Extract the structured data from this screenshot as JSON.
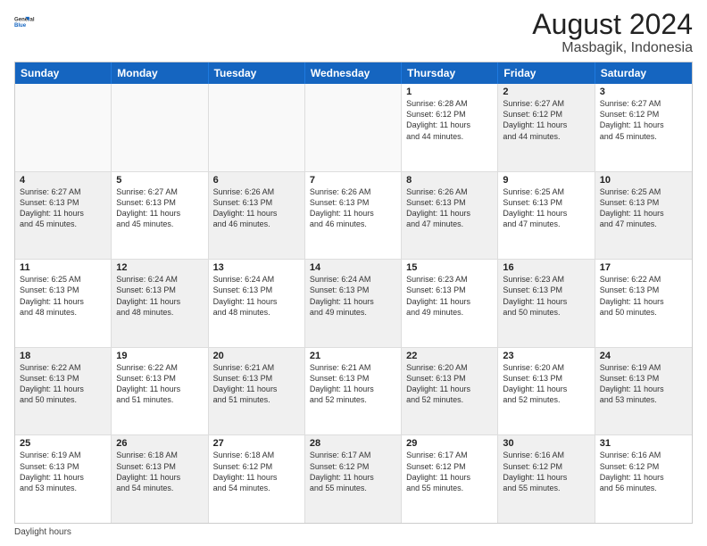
{
  "header": {
    "logo_general": "General",
    "logo_blue": "Blue",
    "month_title": "August 2024",
    "location": "Masbagik, Indonesia"
  },
  "days_of_week": [
    "Sunday",
    "Monday",
    "Tuesday",
    "Wednesday",
    "Thursday",
    "Friday",
    "Saturday"
  ],
  "footer": {
    "daylight_label": "Daylight hours"
  },
  "rows": [
    [
      {
        "day": "",
        "text": "",
        "shaded": false,
        "empty": true
      },
      {
        "day": "",
        "text": "",
        "shaded": false,
        "empty": true
      },
      {
        "day": "",
        "text": "",
        "shaded": false,
        "empty": true
      },
      {
        "day": "",
        "text": "",
        "shaded": false,
        "empty": true
      },
      {
        "day": "1",
        "text": "Sunrise: 6:28 AM\nSunset: 6:12 PM\nDaylight: 11 hours\nand 44 minutes.",
        "shaded": false,
        "empty": false
      },
      {
        "day": "2",
        "text": "Sunrise: 6:27 AM\nSunset: 6:12 PM\nDaylight: 11 hours\nand 44 minutes.",
        "shaded": true,
        "empty": false
      },
      {
        "day": "3",
        "text": "Sunrise: 6:27 AM\nSunset: 6:12 PM\nDaylight: 11 hours\nand 45 minutes.",
        "shaded": false,
        "empty": false
      }
    ],
    [
      {
        "day": "4",
        "text": "Sunrise: 6:27 AM\nSunset: 6:13 PM\nDaylight: 11 hours\nand 45 minutes.",
        "shaded": true,
        "empty": false
      },
      {
        "day": "5",
        "text": "Sunrise: 6:27 AM\nSunset: 6:13 PM\nDaylight: 11 hours\nand 45 minutes.",
        "shaded": false,
        "empty": false
      },
      {
        "day": "6",
        "text": "Sunrise: 6:26 AM\nSunset: 6:13 PM\nDaylight: 11 hours\nand 46 minutes.",
        "shaded": true,
        "empty": false
      },
      {
        "day": "7",
        "text": "Sunrise: 6:26 AM\nSunset: 6:13 PM\nDaylight: 11 hours\nand 46 minutes.",
        "shaded": false,
        "empty": false
      },
      {
        "day": "8",
        "text": "Sunrise: 6:26 AM\nSunset: 6:13 PM\nDaylight: 11 hours\nand 47 minutes.",
        "shaded": true,
        "empty": false
      },
      {
        "day": "9",
        "text": "Sunrise: 6:25 AM\nSunset: 6:13 PM\nDaylight: 11 hours\nand 47 minutes.",
        "shaded": false,
        "empty": false
      },
      {
        "day": "10",
        "text": "Sunrise: 6:25 AM\nSunset: 6:13 PM\nDaylight: 11 hours\nand 47 minutes.",
        "shaded": true,
        "empty": false
      }
    ],
    [
      {
        "day": "11",
        "text": "Sunrise: 6:25 AM\nSunset: 6:13 PM\nDaylight: 11 hours\nand 48 minutes.",
        "shaded": false,
        "empty": false
      },
      {
        "day": "12",
        "text": "Sunrise: 6:24 AM\nSunset: 6:13 PM\nDaylight: 11 hours\nand 48 minutes.",
        "shaded": true,
        "empty": false
      },
      {
        "day": "13",
        "text": "Sunrise: 6:24 AM\nSunset: 6:13 PM\nDaylight: 11 hours\nand 48 minutes.",
        "shaded": false,
        "empty": false
      },
      {
        "day": "14",
        "text": "Sunrise: 6:24 AM\nSunset: 6:13 PM\nDaylight: 11 hours\nand 49 minutes.",
        "shaded": true,
        "empty": false
      },
      {
        "day": "15",
        "text": "Sunrise: 6:23 AM\nSunset: 6:13 PM\nDaylight: 11 hours\nand 49 minutes.",
        "shaded": false,
        "empty": false
      },
      {
        "day": "16",
        "text": "Sunrise: 6:23 AM\nSunset: 6:13 PM\nDaylight: 11 hours\nand 50 minutes.",
        "shaded": true,
        "empty": false
      },
      {
        "day": "17",
        "text": "Sunrise: 6:22 AM\nSunset: 6:13 PM\nDaylight: 11 hours\nand 50 minutes.",
        "shaded": false,
        "empty": false
      }
    ],
    [
      {
        "day": "18",
        "text": "Sunrise: 6:22 AM\nSunset: 6:13 PM\nDaylight: 11 hours\nand 50 minutes.",
        "shaded": true,
        "empty": false
      },
      {
        "day": "19",
        "text": "Sunrise: 6:22 AM\nSunset: 6:13 PM\nDaylight: 11 hours\nand 51 minutes.",
        "shaded": false,
        "empty": false
      },
      {
        "day": "20",
        "text": "Sunrise: 6:21 AM\nSunset: 6:13 PM\nDaylight: 11 hours\nand 51 minutes.",
        "shaded": true,
        "empty": false
      },
      {
        "day": "21",
        "text": "Sunrise: 6:21 AM\nSunset: 6:13 PM\nDaylight: 11 hours\nand 52 minutes.",
        "shaded": false,
        "empty": false
      },
      {
        "day": "22",
        "text": "Sunrise: 6:20 AM\nSunset: 6:13 PM\nDaylight: 11 hours\nand 52 minutes.",
        "shaded": true,
        "empty": false
      },
      {
        "day": "23",
        "text": "Sunrise: 6:20 AM\nSunset: 6:13 PM\nDaylight: 11 hours\nand 52 minutes.",
        "shaded": false,
        "empty": false
      },
      {
        "day": "24",
        "text": "Sunrise: 6:19 AM\nSunset: 6:13 PM\nDaylight: 11 hours\nand 53 minutes.",
        "shaded": true,
        "empty": false
      }
    ],
    [
      {
        "day": "25",
        "text": "Sunrise: 6:19 AM\nSunset: 6:13 PM\nDaylight: 11 hours\nand 53 minutes.",
        "shaded": false,
        "empty": false
      },
      {
        "day": "26",
        "text": "Sunrise: 6:18 AM\nSunset: 6:13 PM\nDaylight: 11 hours\nand 54 minutes.",
        "shaded": true,
        "empty": false
      },
      {
        "day": "27",
        "text": "Sunrise: 6:18 AM\nSunset: 6:12 PM\nDaylight: 11 hours\nand 54 minutes.",
        "shaded": false,
        "empty": false
      },
      {
        "day": "28",
        "text": "Sunrise: 6:17 AM\nSunset: 6:12 PM\nDaylight: 11 hours\nand 55 minutes.",
        "shaded": true,
        "empty": false
      },
      {
        "day": "29",
        "text": "Sunrise: 6:17 AM\nSunset: 6:12 PM\nDaylight: 11 hours\nand 55 minutes.",
        "shaded": false,
        "empty": false
      },
      {
        "day": "30",
        "text": "Sunrise: 6:16 AM\nSunset: 6:12 PM\nDaylight: 11 hours\nand 55 minutes.",
        "shaded": true,
        "empty": false
      },
      {
        "day": "31",
        "text": "Sunrise: 6:16 AM\nSunset: 6:12 PM\nDaylight: 11 hours\nand 56 minutes.",
        "shaded": false,
        "empty": false
      }
    ]
  ]
}
